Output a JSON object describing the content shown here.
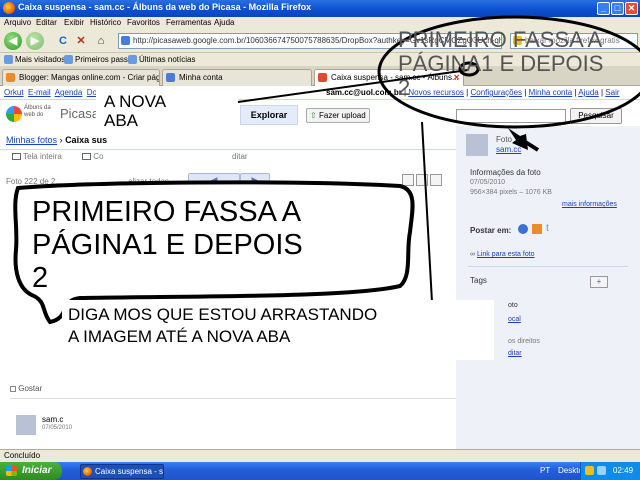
{
  "window": {
    "title": "Caixa suspensa - sam.cc - Álbuns da web do Picasa - Mozilla Firefox",
    "min": "_",
    "max": "□",
    "close": "✕"
  },
  "menu": [
    "Arquivo",
    "Editar",
    "Exibir",
    "Histórico",
    "Favoritos",
    "Ferramentas",
    "Ajuda"
  ],
  "nav": {
    "back": "◀",
    "forward": "▶",
    "reload": "C",
    "stop": "✕",
    "home": "⌂",
    "url": "http://picasaweb.google.com.br/106036674750075788635/DropBox?authkey=Gv1sRgCMOZgQ3Uch-qhwEalt#",
    "search_value": "baixar mozilla firefox gratis"
  },
  "bookmarks": [
    "Mais visitados",
    "Primeiros passos",
    "Últimas notícias"
  ],
  "tabs": [
    {
      "label": "Blogger: Mangas online.com - Criar pág...",
      "color": "#f08a24"
    },
    {
      "label": "Minha conta",
      "color": "#4a7bd8"
    },
    {
      "label": "Caixa suspensa - sam.cc - Álbuns...",
      "color": "#e2492f"
    }
  ],
  "page": {
    "topnav": [
      "Orkut",
      "E-mail",
      "Agenda",
      "Docs"
    ],
    "account": {
      "email": "sam.cc@uol.com.br",
      "links": [
        "Novos recursos",
        "Configurações",
        "Minha conta",
        "Ajuda",
        "Sair"
      ]
    },
    "logo": {
      "line1": "Álbuns da",
      "line2": "web do",
      "word": "Picasa"
    },
    "explore": "Explorar",
    "upload": "Fazer upload",
    "search_button": "Pesquisar",
    "breadcrumb": {
      "root": "Minhas fotos",
      "sep": "›",
      "current": "Caixa sus"
    },
    "toolbar": {
      "fullscreen": "Tela inteira",
      "comment": "Co",
      "edit": "ditar"
    },
    "photo_counter": "Foto 222 de 2...",
    "slideshow": "alizar todas",
    "like": "Gostar",
    "comment_author": "sam.c",
    "comment_date": "07/05/2010",
    "side": {
      "owner_label": "Foto",
      "owner": "sam.cc",
      "info_title": "Informações da foto",
      "date": "07/05/2010",
      "dims": "956×384 pixels – 1076 KB",
      "more": "mais informações",
      "post_label": "Postar em:",
      "link": "Link para esta foto",
      "tags": "Tags",
      "tag_add": "+",
      "location": "oto",
      "local": "ocal",
      "rights": "os direitos",
      "edit": "ditar"
    }
  },
  "status": "Concluído",
  "taskbar": {
    "start": "Iniciar",
    "item": "Caixa suspensa - sam...",
    "lang": "PT",
    "desktop": "Desktop",
    "clock": "02:49"
  },
  "annotations": {
    "callout_overlay_l1": "PRIMEIRO FASSA A",
    "callout_overlay_l2": "PÁGINA1 E DEPOIS",
    "callout_overlay_l3": "2",
    "new_tab_l1": "A NOVA",
    "new_tab_l2": "ABA",
    "big_l1": "PRIMEIRO FASSA A",
    "big_l2": "PÁGINA1 E DEPOIS",
    "big_l3": "2",
    "box_l1": "DIGA MOS QUE ESTOU ARRASTANDO",
    "box_l2": "A IMAGEM ATÉ A NOVA ABA"
  }
}
